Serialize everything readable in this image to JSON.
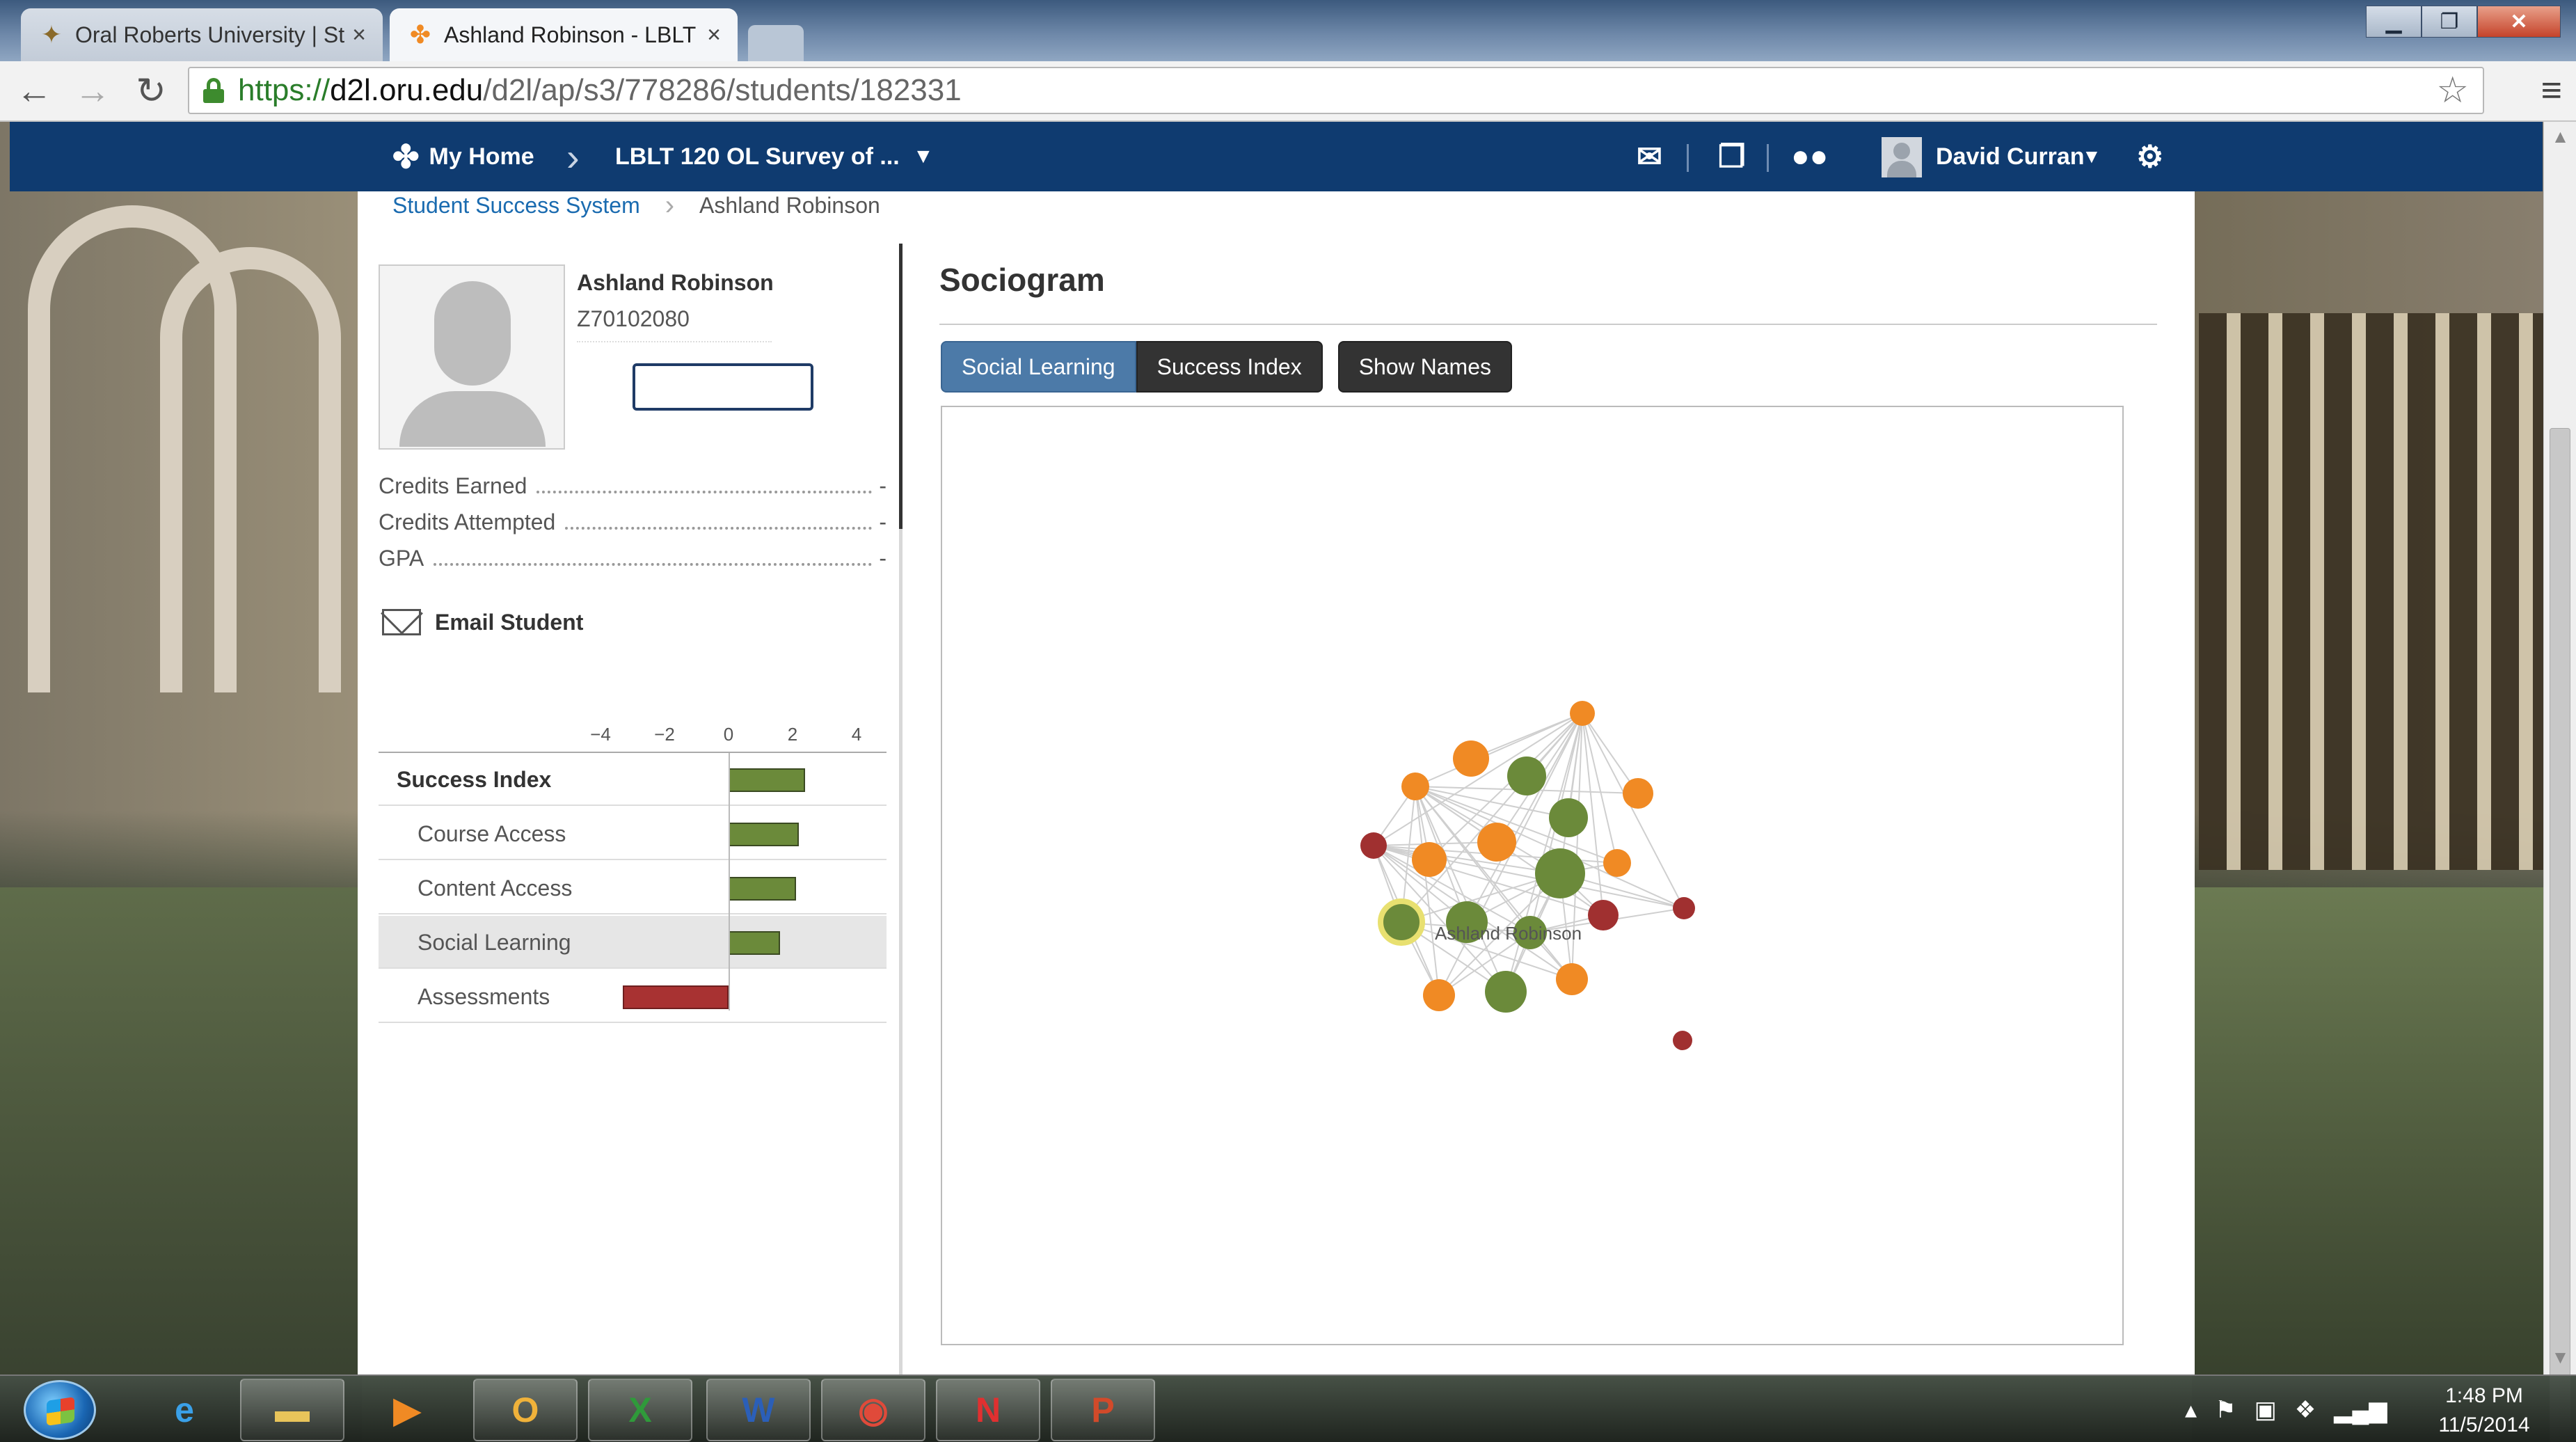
{
  "browser": {
    "tabs": [
      {
        "title": "Oral Roberts University | St",
        "icon": "oru-favicon",
        "active": false
      },
      {
        "title": "Ashland Robinson - LBLT",
        "icon": "d2l-favicon",
        "active": true
      }
    ],
    "close_glyph": "×",
    "url": {
      "scheme": "https://",
      "host": "d2l.oru.edu",
      "path": "/d2l/ap/s3/778286/students/182331"
    },
    "nav_icons": [
      "back-icon",
      "forward-icon",
      "reload-icon",
      "lock-icon",
      "star-icon",
      "menu-icon"
    ]
  },
  "d2l_nav": {
    "home_label": "My Home",
    "course_label": "LBLT 120 OL Survey of ...",
    "user_name": "David Curran",
    "icons": [
      "home-icon",
      "mail-icon",
      "alerts-icon",
      "chat-icon",
      "settings-icon"
    ],
    "bar_color": "#0f3b70"
  },
  "breadcrumb": [
    "Student Success System",
    "Ashland Robinson"
  ],
  "student": {
    "name": "Ashland Robinson",
    "id": "Z70102080",
    "stats": [
      {
        "label": "Credits Earned",
        "value": "-"
      },
      {
        "label": "Credits Attempted",
        "value": "-"
      },
      {
        "label": "GPA",
        "value": "-"
      }
    ],
    "email_label": "Email Student"
  },
  "success_index": {
    "ticks": [
      "−4",
      "−2",
      "0",
      "2",
      "4"
    ],
    "rows": [
      {
        "label": "Success Index",
        "value": 2.4,
        "level": "main"
      },
      {
        "label": "Course Access",
        "value": 2.2,
        "level": "sub"
      },
      {
        "label": "Content Access",
        "value": 2.1,
        "level": "sub"
      },
      {
        "label": "Social Learning",
        "value": 1.6,
        "level": "sub",
        "highlight": true
      },
      {
        "label": "Assessments",
        "value": -3.3,
        "level": "sub"
      }
    ],
    "positive_color": "#6b8a3a",
    "negative_color": "#a83232"
  },
  "sociogram": {
    "title": "Sociogram",
    "buttons": [
      "Social Learning",
      "Success Index",
      "Show Names"
    ],
    "active_button": "Social Learning",
    "node_label": "Ashland Robinson",
    "colors": {
      "green": "#6b8a3a",
      "orange": "#f08a24",
      "red": "#a03030",
      "edge": "#cfcfcf"
    }
  },
  "taskbar": {
    "apps": [
      "start-icon",
      "ie-icon",
      "explorer-icon",
      "media-player-icon",
      "outlook-icon",
      "excel-icon",
      "word-icon",
      "chrome-icon",
      "news-icon",
      "powerpoint-icon"
    ],
    "time": "1:48 PM",
    "date": "11/5/2014"
  }
}
